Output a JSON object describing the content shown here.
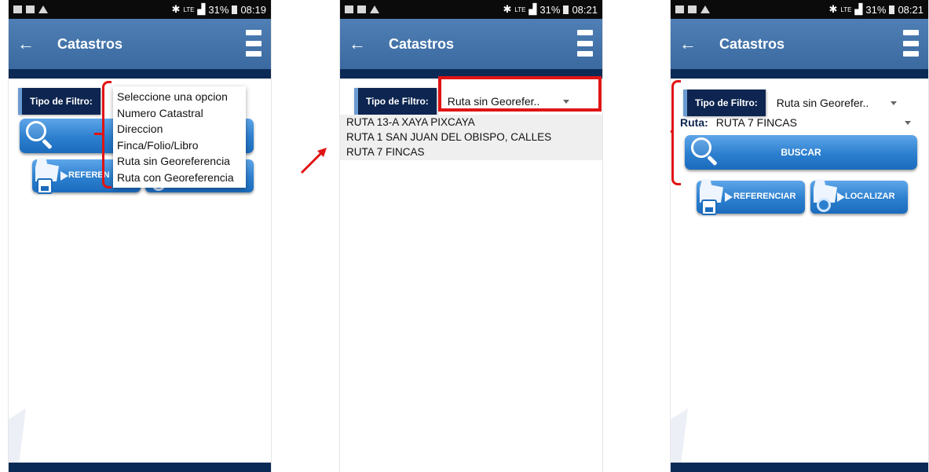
{
  "status_bar": {
    "screen1_time": "08:19",
    "screen2_time": "08:21",
    "screen3_time": "08:21",
    "battery": "31%",
    "network": "LTE"
  },
  "app_bar": {
    "title": "Catastros",
    "back_icon": "arrow-left-icon",
    "menu_icon": "hamburger-icon"
  },
  "filter": {
    "label": "Tipo de Filtro:",
    "selected": "Ruta sin Georefer.."
  },
  "dropdown_options": [
    "Seleccione una opcion",
    "Numero Catastral",
    "Direccion",
    "Finca/Folio/Libro",
    "Ruta sin Georeferencia",
    "Ruta con Georeferencia"
  ],
  "route_list": [
    "RUTA 13-A XAYA PIXCAYA",
    "RUTA 1 SAN JUAN DEL OBISPO, CALLES",
    "RUTA 7 FINCAS"
  ],
  "route_field": {
    "label": "Ruta:",
    "selected": "RUTA 7 FINCAS"
  },
  "buttons": {
    "buscar": "BUSCAR",
    "referenciar": "REFERENCIAR",
    "referenciar_clipped": "REFEREN",
    "localizar": "LOCALIZAR"
  },
  "colors": {
    "appbar": "#4a7ab1",
    "navy": "#0b2a55",
    "button": "#2c7fce",
    "annotation_red": "#e01414"
  }
}
